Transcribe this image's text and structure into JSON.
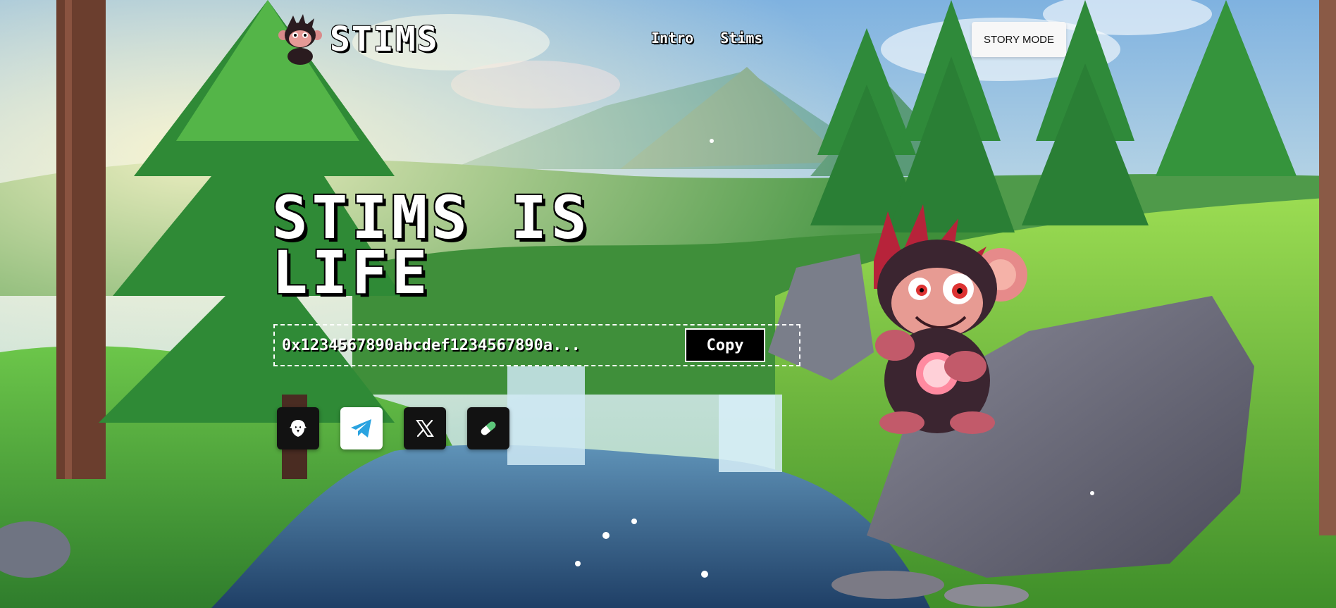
{
  "brand": {
    "name": "STIMS"
  },
  "nav": {
    "items": [
      {
        "label": "Intro"
      },
      {
        "label": "Stims"
      }
    ],
    "story_mode_label": "STORY MODE"
  },
  "hero": {
    "title": "STIMS IS LIFE",
    "contract_address": "0x1234567890abcdef1234567890a...",
    "copy_label": "Copy"
  },
  "socials": [
    {
      "icon": "eagle-icon",
      "theme": "dark"
    },
    {
      "icon": "telegram-icon",
      "theme": "light",
      "color": "#2AA3E0"
    },
    {
      "icon": "x-icon",
      "theme": "dark"
    },
    {
      "icon": "pill-icon",
      "theme": "dark",
      "color": "#5CC77A"
    }
  ],
  "colors": {
    "text": "#FFFFFF",
    "button_dark": "#000000",
    "button_light": "#F7F7F7"
  }
}
